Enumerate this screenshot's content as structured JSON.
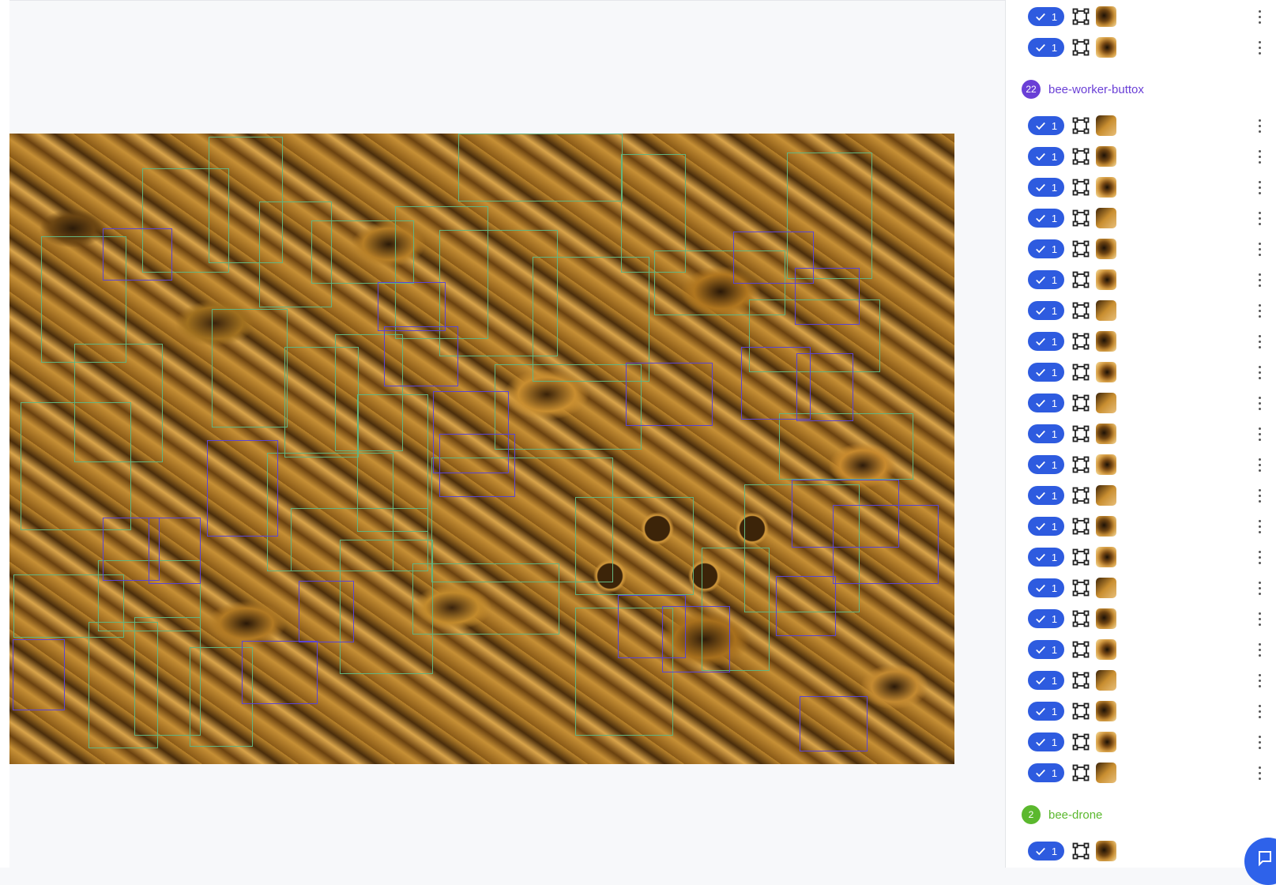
{
  "colors": {
    "accent": "#2e5bdf",
    "box_green": "#62b47f",
    "box_purple": "#5b44d4",
    "group_worker": "#6a3fd6",
    "group_drone": "#5bb82e"
  },
  "icons": {
    "check": "check-icon",
    "bbox": "bounding-box-icon",
    "more": "more-vertical-icon",
    "chat": "chat-icon"
  },
  "top_items": [
    {
      "count": "1"
    },
    {
      "count": "1"
    }
  ],
  "groups": [
    {
      "count": "22",
      "label": "bee-worker-buttox",
      "items": [
        {
          "count": "1"
        },
        {
          "count": "1"
        },
        {
          "count": "1"
        },
        {
          "count": "1"
        },
        {
          "count": "1"
        },
        {
          "count": "1"
        },
        {
          "count": "1"
        },
        {
          "count": "1"
        },
        {
          "count": "1"
        },
        {
          "count": "1"
        },
        {
          "count": "1"
        },
        {
          "count": "1"
        },
        {
          "count": "1"
        },
        {
          "count": "1"
        },
        {
          "count": "1"
        },
        {
          "count": "1"
        },
        {
          "count": "1"
        },
        {
          "count": "1"
        },
        {
          "count": "1"
        },
        {
          "count": "1"
        },
        {
          "count": "1"
        },
        {
          "count": "1"
        }
      ]
    },
    {
      "count": "2",
      "label": "bee-drone",
      "items": [
        {
          "count": "1"
        }
      ]
    }
  ]
}
